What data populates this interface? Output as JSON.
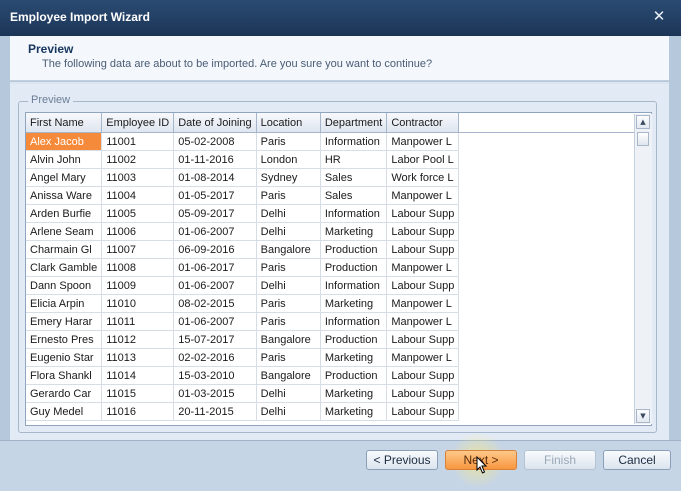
{
  "window": {
    "title": "Employee Import Wizard"
  },
  "header": {
    "title": "Preview",
    "subtitle": "The following data are about to be imported. Are you sure you want to continue?"
  },
  "group": {
    "caption": "Preview"
  },
  "grid": {
    "columns": [
      "First Name",
      "Employee ID",
      "Date of Joining",
      "Location",
      "Department",
      "Contractor"
    ],
    "rows": [
      [
        "Alex Jacob",
        "11001",
        "05-02-2008",
        "Paris",
        "Information",
        "Manpower L"
      ],
      [
        "Alvin John",
        "11002",
        "01-11-2016",
        "London",
        "HR",
        "Labor Pool L"
      ],
      [
        "Angel Mary",
        "11003",
        "01-08-2014",
        "Sydney",
        "Sales",
        "Work force L"
      ],
      [
        "Anissa Ware",
        "11004",
        "01-05-2017",
        "Paris",
        "Sales",
        "Manpower L"
      ],
      [
        "Arden Burfie",
        "11005",
        "05-09-2017",
        "Delhi",
        "Information",
        "Labour Supp"
      ],
      [
        "Arlene Seam",
        "11006",
        "01-06-2007",
        "Delhi",
        "Marketing",
        "Labour Supp"
      ],
      [
        "Charmain Gl",
        "11007",
        "06-09-2016",
        "Bangalore",
        "Production",
        "Labour Supp"
      ],
      [
        "Clark Gamble",
        "11008",
        "01-06-2017",
        "Paris",
        "Production",
        "Manpower L"
      ],
      [
        "Dann Spoon",
        "11009",
        "01-06-2007",
        "Delhi",
        "Information",
        "Labour Supp"
      ],
      [
        "Elicia Arpin",
        "11010",
        "08-02-2015",
        "Paris",
        "Marketing",
        "Manpower L"
      ],
      [
        "Emery Harar",
        "11011",
        "01-06-2007",
        "Paris",
        "Information",
        "Manpower L"
      ],
      [
        "Ernesto Pres",
        "11012",
        "15-07-2017",
        "Bangalore",
        "Production",
        "Labour Supp"
      ],
      [
        "Eugenio Star",
        "11013",
        "02-02-2016",
        "Paris",
        "Marketing",
        "Manpower L"
      ],
      [
        "Flora Shankl",
        "11014",
        "15-03-2010",
        "Bangalore",
        "Production",
        "Labour Supp"
      ],
      [
        "Gerardo Car",
        "11015",
        "01-03-2015",
        "Delhi",
        "Marketing",
        "Labour Supp"
      ],
      [
        "Guy Medel",
        "11016",
        "20-11-2015",
        "Delhi",
        "Marketing",
        "Labour Supp"
      ]
    ]
  },
  "buttons": {
    "previous": "< Previous",
    "next": "Next >",
    "finish": "Finish",
    "cancel": "Cancel"
  },
  "icons": {
    "close": "close-icon",
    "scroll_up": "scroll-up-arrow-icon",
    "scroll_down": "scroll-down-arrow-icon",
    "cursor": "mouse-pointer-icon"
  },
  "colors": {
    "titlebar": "#1f3c63",
    "selected_cell": "#f58a3a",
    "next_button": "#f7973f"
  }
}
